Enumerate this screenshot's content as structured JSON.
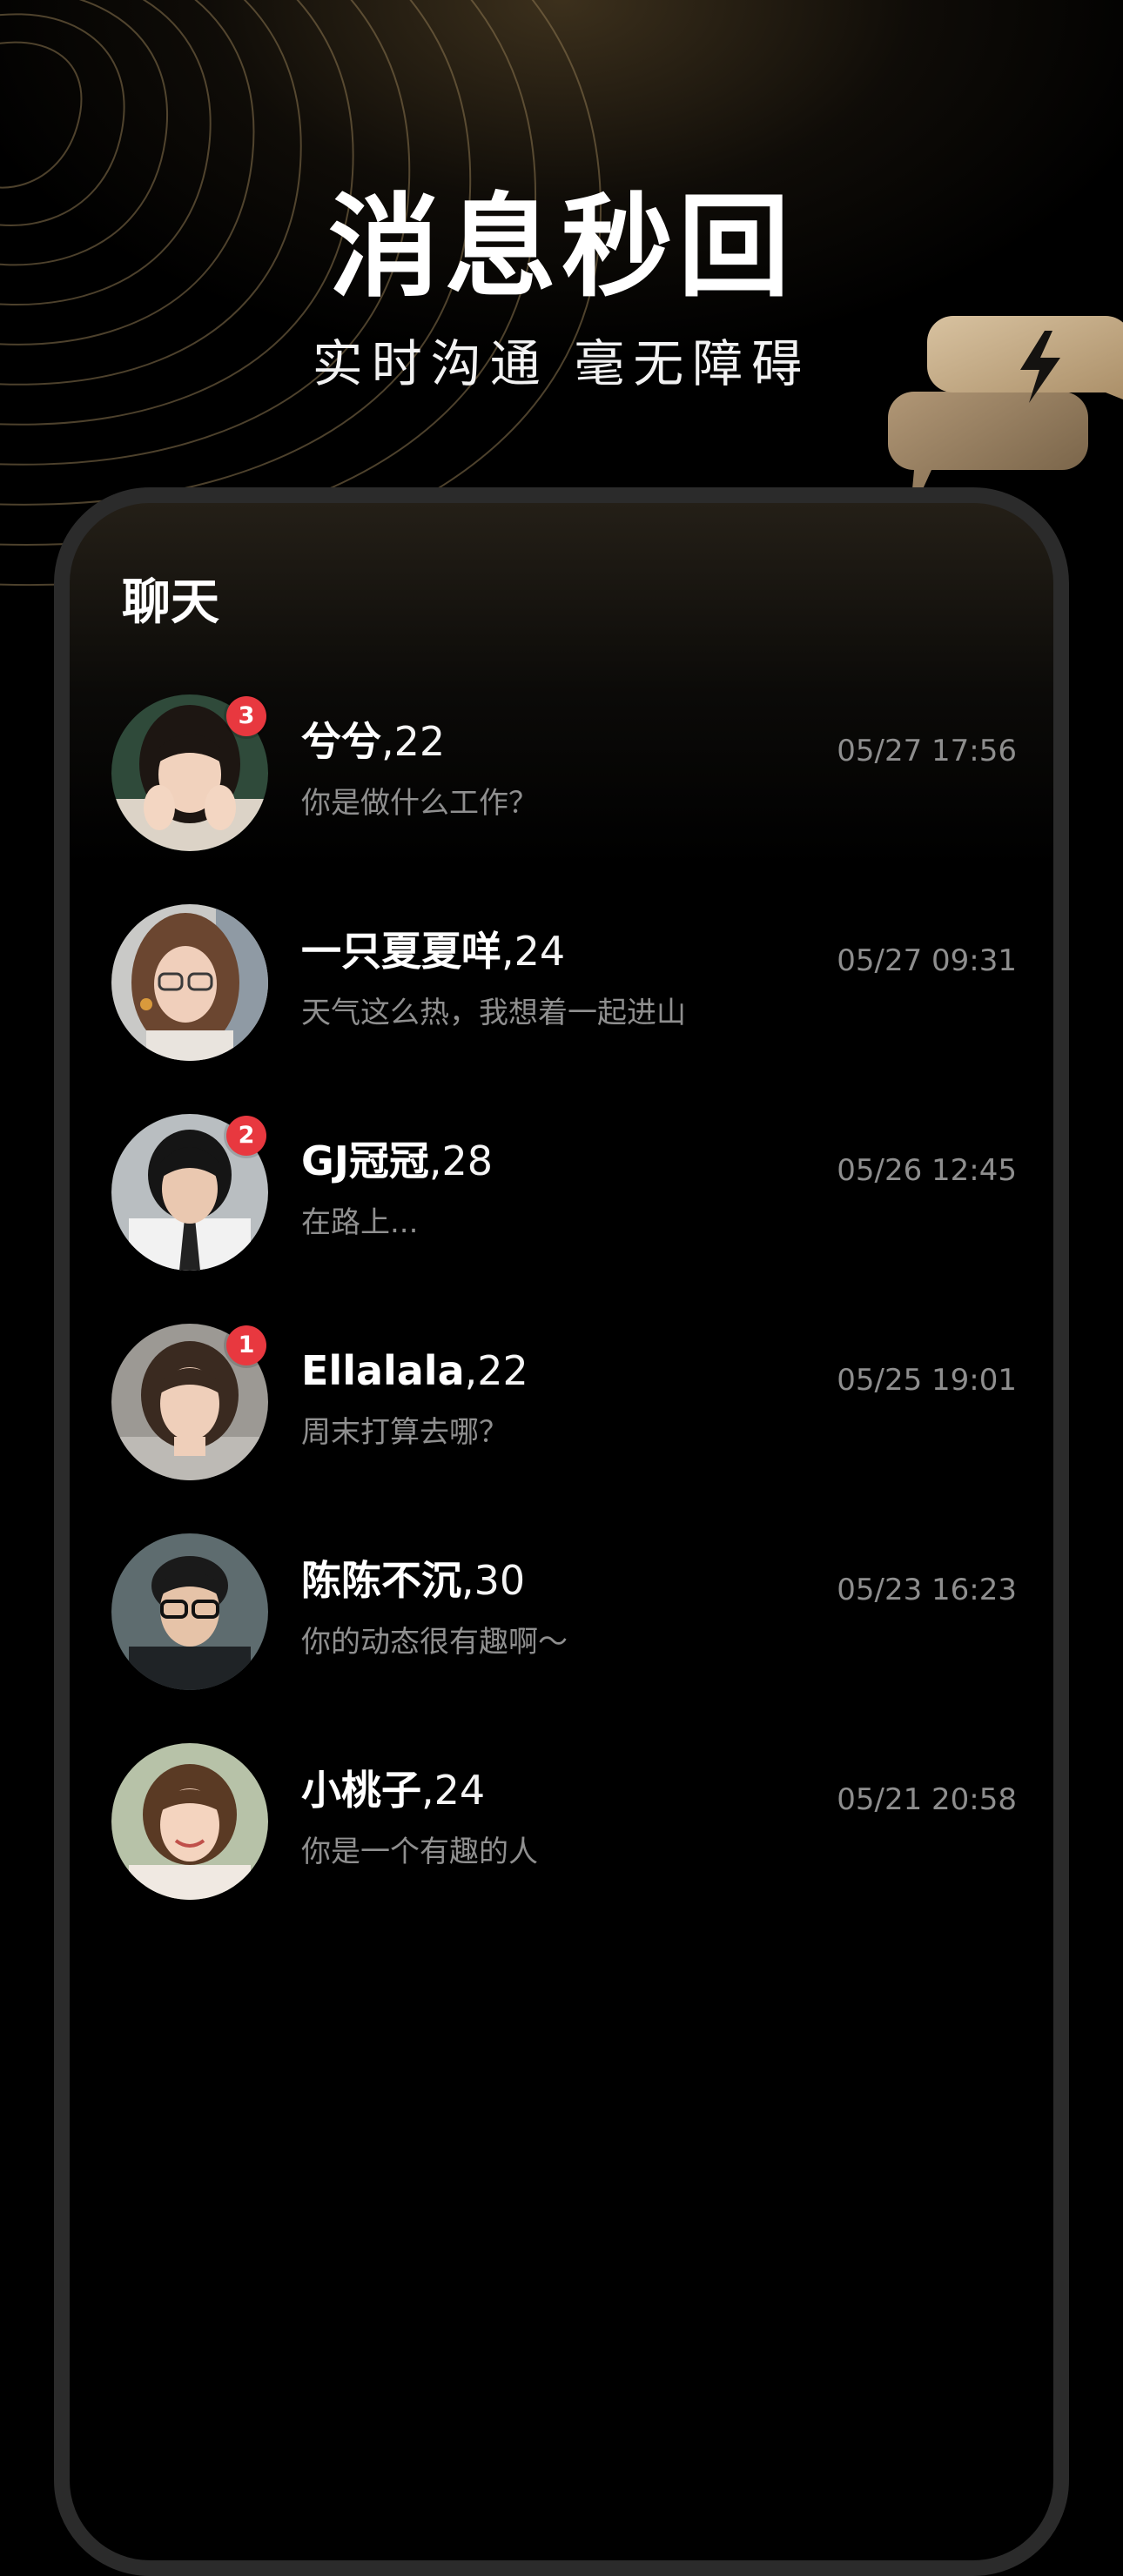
{
  "headline": "消息秒回",
  "subline": "实时沟通 毫无障碍",
  "panel_title": "聊天",
  "icons": {
    "bubble": "lightning-chat-bubble-icon"
  },
  "colors": {
    "background": "#000000",
    "gold_accent": "#c7a97c",
    "badge_red": "#e8383f",
    "preview_gray": "#8f8f8f"
  },
  "chats": [
    {
      "name": "兮兮",
      "age": ",22",
      "message": "你是做什么工作？",
      "time": "05/27 17:56",
      "unread": "3"
    },
    {
      "name": "一只夏夏咩",
      "age": ",24",
      "message": "天气这么热，我想着一起进山",
      "time": "05/27 09:31",
      "unread": ""
    },
    {
      "name": "GJ冠冠",
      "age": ",28",
      "message": "在路上...",
      "time": "05/26 12:45",
      "unread": "2"
    },
    {
      "name": "Ellalala",
      "age": ",22",
      "message": "周末打算去哪？",
      "time": "05/25 19:01",
      "unread": "1"
    },
    {
      "name": "陈陈不沉",
      "age": ",30",
      "message": "你的动态很有趣啊～",
      "time": "05/23 16:23",
      "unread": ""
    },
    {
      "name": "小桃子",
      "age": ",24",
      "message": "你是一个有趣的人",
      "time": "05/21 20:58",
      "unread": ""
    }
  ]
}
